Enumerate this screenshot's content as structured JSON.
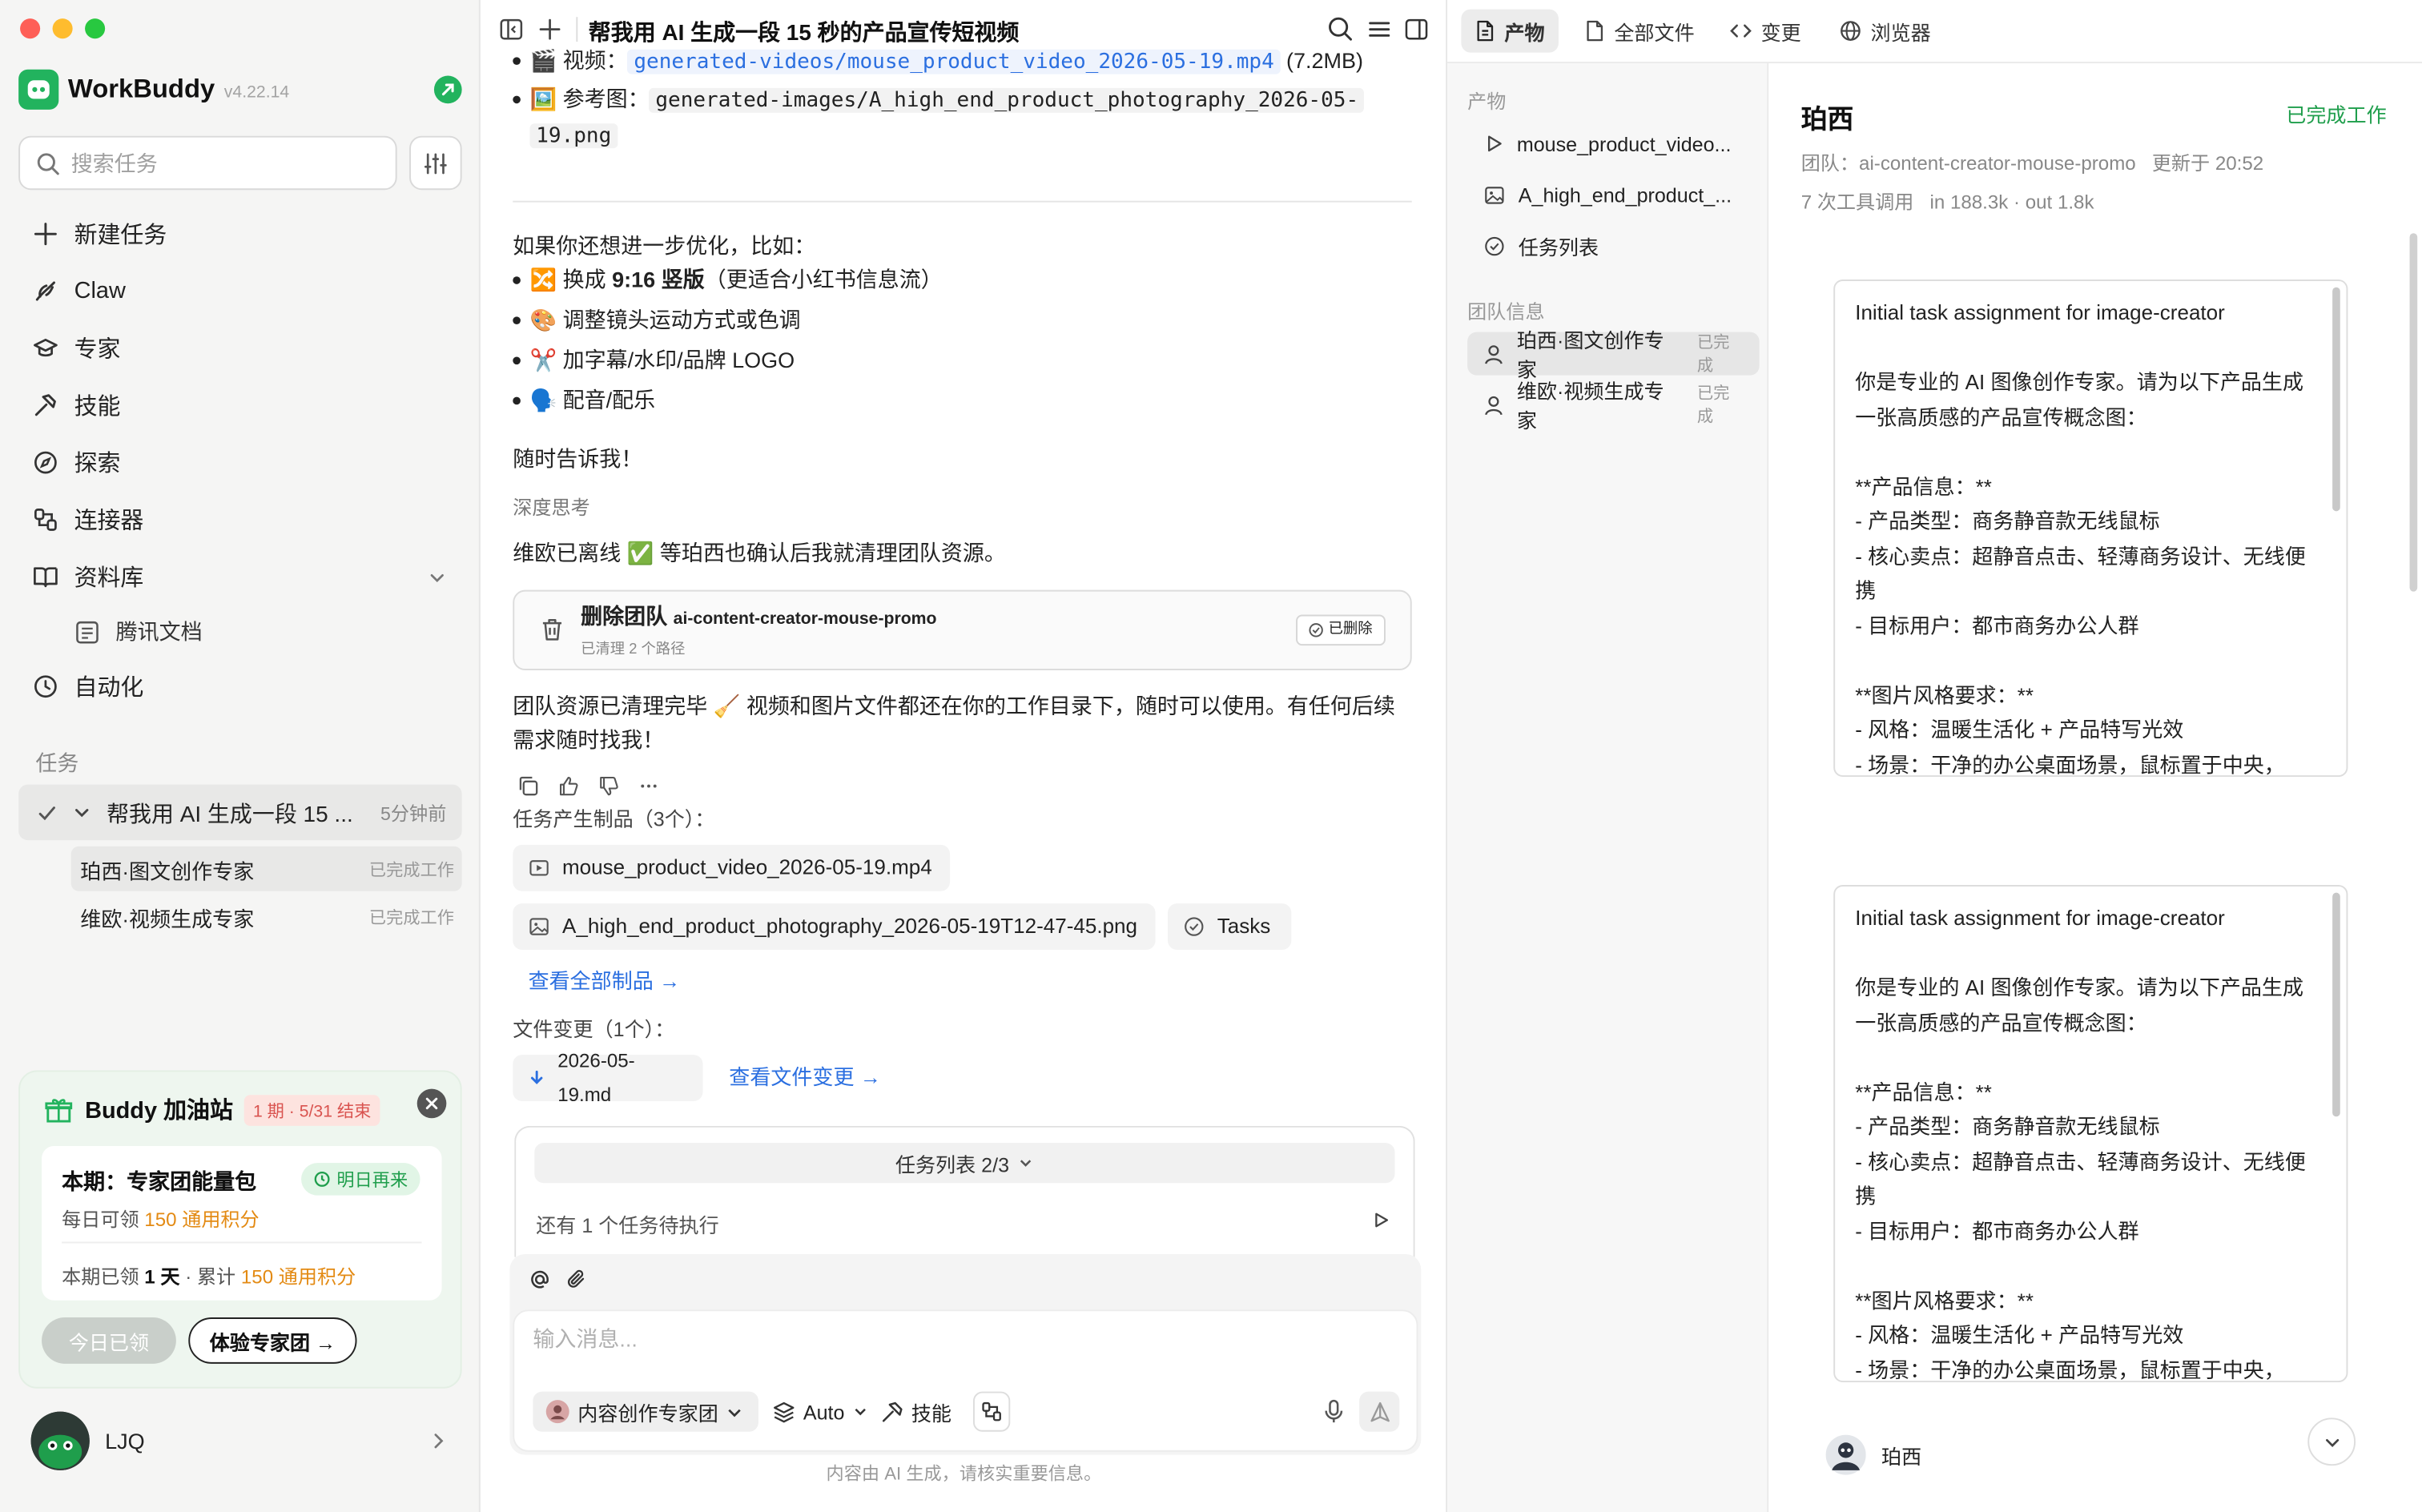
{
  "app": {
    "name": "WorkBuddy",
    "version": "v4.22.14"
  },
  "sidebar": {
    "search_placeholder": "搜索任务",
    "nav": [
      {
        "label": "新建任务",
        "icon": "plus-icon"
      },
      {
        "label": "Claw",
        "icon": "claw-icon"
      },
      {
        "label": "专家",
        "icon": "graduation-cap-icon"
      },
      {
        "label": "技能",
        "icon": "tool-icon"
      },
      {
        "label": "探索",
        "icon": "compass-icon"
      },
      {
        "label": "连接器",
        "icon": "connector-icon"
      },
      {
        "label": "资料库",
        "icon": "book-icon"
      },
      {
        "label": "自动化",
        "icon": "clock-icon"
      }
    ],
    "library_sub": "腾讯文档",
    "tasks_label": "任务",
    "task": {
      "title": "帮我用 AI 生成一段 15 ...",
      "time": "5分钟前"
    },
    "subtasks": [
      {
        "label": "珀西·图文创作专家",
        "status": "已完成工作"
      },
      {
        "label": "维欧·视频生成专家",
        "status": "已完成工作"
      }
    ],
    "promo": {
      "title": "Buddy 加油站",
      "tag": "1 期 · 5/31 结束",
      "card_title": "本期：专家团能量包",
      "pill": "明日再来",
      "daily_prefix": "每日可领 ",
      "daily_value": "150 通用积分",
      "claimed_prefix": "本期已领 ",
      "claimed_days": "1 天",
      "claimed_mid": " · 累计 ",
      "claimed_total": "150 通用积分",
      "btn_claimed": "今日已领",
      "btn_try": "体验专家团 →"
    },
    "user": {
      "name": "LJQ"
    }
  },
  "main": {
    "title": "帮我用 AI 生成一段 15 秒的产品宣传短视频",
    "video_label": "视频：",
    "video_path": "generated-videos/mouse_product_video_2026-05-19.mp4",
    "video_size": "(7.2MB)",
    "ref_label": "参考图：",
    "ref_path_1": "generated-images/A_high_end_product_photography_2026-05-",
    "ref_path_2": "19.png",
    "optimize_intro": "如果你还想进一步优化，比如：",
    "optimize_items": [
      {
        "emoji": "🔀",
        "pre": "换成 ",
        "bold": "9:16 竖版",
        "post": "（更适合小红书信息流）"
      },
      {
        "emoji": "🎨",
        "pre": "调整镜头运动方式或色调",
        "bold": "",
        "post": ""
      },
      {
        "emoji": "✂️",
        "pre": "加字幕/水印/品牌 LOGO",
        "bold": "",
        "post": ""
      },
      {
        "emoji": "🗣️",
        "pre": "配音/配乐",
        "bold": "",
        "post": ""
      }
    ],
    "tell_me": "随时告诉我！",
    "deep_think": "深度思考",
    "status_line": "维欧已离线 ✅ 等珀西也确认后我就清理团队资源。",
    "delete_card": {
      "title": "删除团队",
      "team": "ai-content-creator-mouse-promo",
      "sub": "已清理 2 个路径",
      "badge": "已删除"
    },
    "cleaned_text": "团队资源已清理完毕 🧹 视频和图片文件都还在你的工作目录下，随时可以使用。有任何后续需求随时找我！",
    "artifacts_label": "任务产生制品（3个）：",
    "artifacts": [
      {
        "label": "mouse_product_video_2026-05-19.mp4",
        "icon": "video-file-icon"
      },
      {
        "label": "A_high_end_product_photography_2026-05-19T12-47-45.png",
        "icon": "image-file-icon"
      },
      {
        "label": "Tasks",
        "icon": "check-circle-icon"
      }
    ],
    "view_all": "查看全部制品 →",
    "changes_label": "文件变更（1个）：",
    "change_file": "2026-05-19.md",
    "view_changes": "查看文件变更 →",
    "tasklist": {
      "head": "任务列表 2/3",
      "pending": "还有 1 个任务待执行"
    },
    "composer": {
      "placeholder": "输入消息...",
      "team": "内容创作专家团",
      "model": "Auto",
      "skill": "技能"
    },
    "footer": "内容由 AI 生成，请核实重要信息。"
  },
  "right": {
    "tabs": [
      {
        "label": "产物",
        "icon": "document-icon"
      },
      {
        "label": "全部文件",
        "icon": "file-icon"
      },
      {
        "label": "变更",
        "icon": "code-icon"
      },
      {
        "label": "浏览器",
        "icon": "globe-icon"
      }
    ],
    "artifacts_label": "产物",
    "artifact_items": [
      {
        "label": "mouse_product_video...",
        "icon": "play-icon"
      },
      {
        "label": "A_high_end_product_...",
        "icon": "image-icon"
      },
      {
        "label": "任务列表",
        "icon": "check-circle-icon"
      }
    ],
    "team_label": "团队信息",
    "team_items": [
      {
        "label": "珀西·图文创作专家",
        "status": "已完成"
      },
      {
        "label": "维欧·视频生成专家",
        "status": "已完成"
      }
    ],
    "detail": {
      "name": "珀西",
      "status": "已完成工作",
      "team_line": "团队：ai-content-creator-mouse-promo",
      "updated": "更新于 20:52",
      "calls": "7 次工具调用",
      "tokens": "in 188.3k · out 1.8k",
      "message": "Initial task assignment for image-creator\n\n你是专业的 AI 图像创作专家。请为以下产品生成一张高质感的产品宣传概念图：\n\n**产品信息：**\n- 产品类型：商务静音款无线鼠标\n- 核心卖点：超静音点击、轻薄商务设计、无线便携\n- 目标用户：都市商务办公人群\n\n**图片风格要求：**\n- 风格：温暖生活化 + 产品特写光效\n- 场景：干净的办公桌面场景，鼠标置于中央，",
      "footer_name": "珀西"
    }
  },
  "colors": {
    "brand_green": "#22b35e",
    "link_blue": "#2b6fe0",
    "accent_orange": "#e38a13"
  }
}
